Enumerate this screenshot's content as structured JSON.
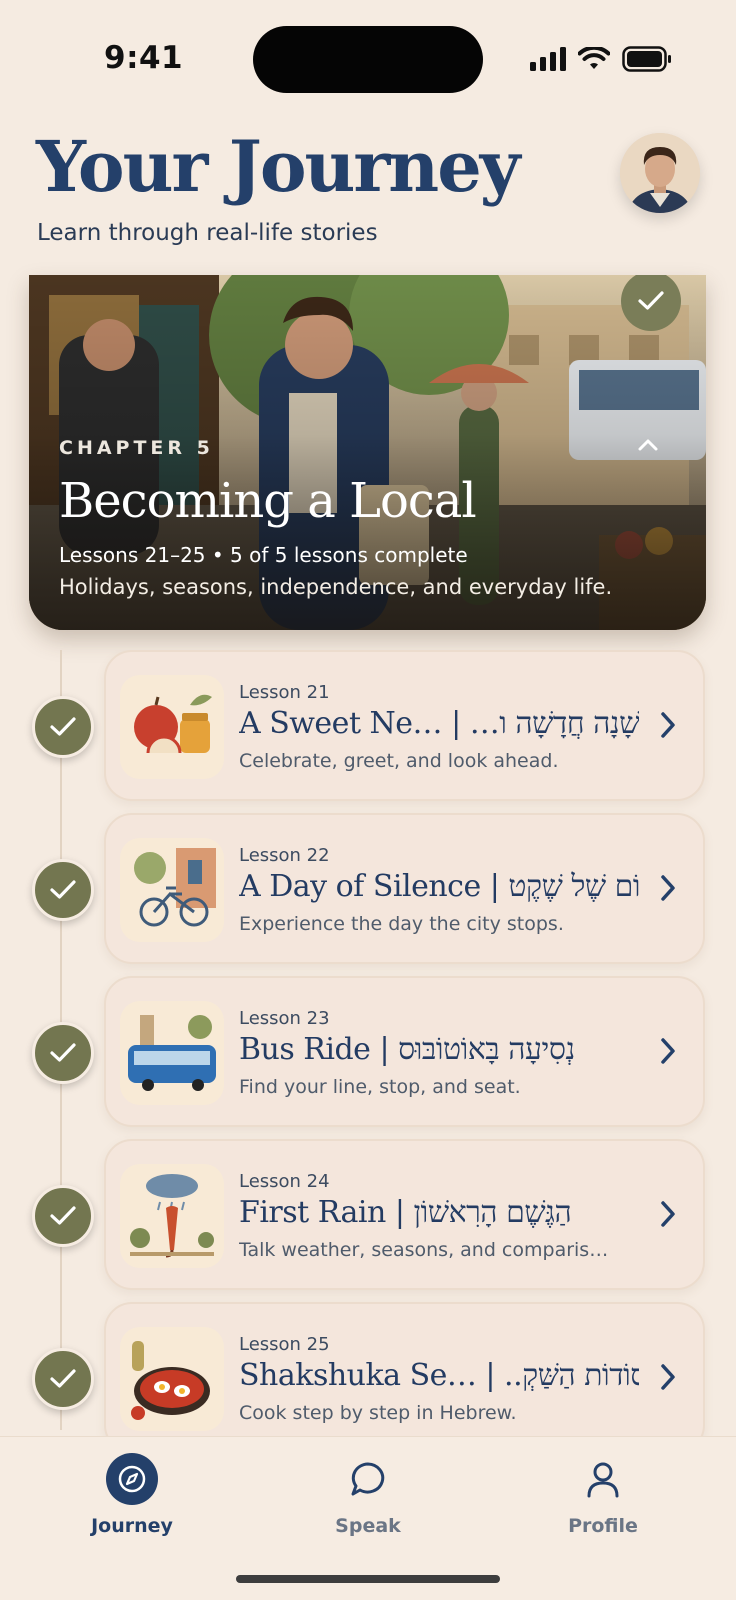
{
  "status_bar": {
    "time": "9:41"
  },
  "header": {
    "title": "Your Journey",
    "subtitle": "Learn through real-life stories"
  },
  "chapter": {
    "label": "CHAPTER 5",
    "title": "Becoming a Local",
    "meta": "Lessons 21–25  •  5 of 5 lessons complete",
    "description": "Holidays, seasons, independence, and everyday life.",
    "progress": 1.0
  },
  "lessons": [
    {
      "number": "Lesson 21",
      "title": "A Sweet Ne…  |  …שָׁנָה חֲדָשָׁה ו",
      "description": "Celebrate, greet, and look ahead.",
      "completed": true,
      "thumb": "apple-honey-icon"
    },
    {
      "number": "Lesson 22",
      "title": "A Day of Silence | יוֹם שֶׁל שֶׁקֶט",
      "description": "Experience the day the city stops.",
      "completed": true,
      "thumb": "bicycle-icon"
    },
    {
      "number": "Lesson 23",
      "title": "Bus Ride | נְסִיעָה בָּאוֹטוֹבּוּס",
      "description": "Find your line, stop, and seat.",
      "completed": true,
      "thumb": "bus-icon"
    },
    {
      "number": "Lesson 24",
      "title": "First Rain | הַגֶּשֶׁם הָרִאשׁוֹן",
      "description": "Talk weather, seasons, and comparis…",
      "completed": true,
      "thumb": "umbrella-rain-icon"
    },
    {
      "number": "Lesson 25",
      "title": "Shakshuka Se…  |  ..סוֹדוֹת הַשַּׁקְ",
      "description": "Cook step by step in Hebrew.",
      "completed": true,
      "thumb": "shakshuka-pan-icon"
    }
  ],
  "tabs": [
    {
      "label": "Journey",
      "icon": "compass-icon",
      "active": true
    },
    {
      "label": "Speak",
      "icon": "chat-bubble-icon",
      "active": false
    },
    {
      "label": "Profile",
      "icon": "person-icon",
      "active": false
    }
  ],
  "colors": {
    "background": "#f5ebe1",
    "primary": "#24406a",
    "check_olive": "#737650",
    "card": "#f4e6dc"
  }
}
